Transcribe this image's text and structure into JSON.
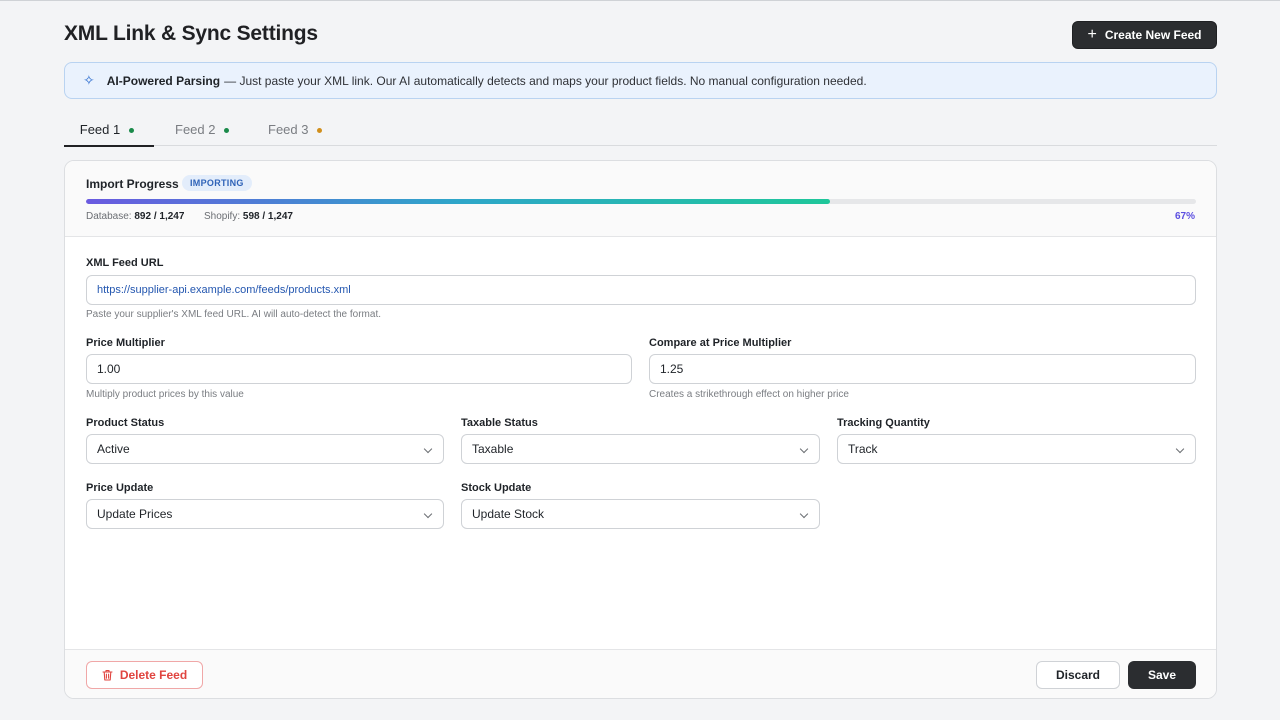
{
  "header": {
    "title": "XML Link & Sync Settings",
    "create_button_label": "Create New Feed"
  },
  "banner": {
    "icon": "sparkle-icon",
    "strong_text": "AI-Powered Parsing",
    "rest_text": "— Just paste your XML link. Our AI automatically detects and maps your product fields. No manual configuration needed."
  },
  "tabs": [
    {
      "label": "Feed 1",
      "status_color": "#1a8a4a",
      "active": true
    },
    {
      "label": "Feed 2",
      "status_color": "#1a8a4a",
      "active": false
    },
    {
      "label": "Feed 3",
      "status_color": "#d18f1c",
      "active": false
    }
  ],
  "progress": {
    "title": "Import Progress",
    "badge": "IMPORTING",
    "fraction": 0.67,
    "database_label": "Database:",
    "database_value": "892 / 1,247",
    "shopify_label": "Shopify:",
    "shopify_value": "598 / 1,247",
    "percent_text": "67%"
  },
  "form": {
    "url": {
      "label": "XML Feed URL",
      "value": "https://supplier-api.example.com/feeds/products.xml",
      "hint": "Paste your supplier's XML feed URL. AI will auto-detect the format."
    },
    "price_multiplier": {
      "label": "Price Multiplier",
      "value": "1.00",
      "hint": "Multiply product prices by this value"
    },
    "compare_multiplier": {
      "label": "Compare at Price Multiplier",
      "value": "1.25",
      "hint": "Creates a strikethrough effect on higher price"
    },
    "product_status": {
      "label": "Product Status",
      "value": "Active"
    },
    "taxable_status": {
      "label": "Taxable Status",
      "value": "Taxable"
    },
    "tracking_quantity": {
      "label": "Tracking Quantity",
      "value": "Track"
    },
    "price_update": {
      "label": "Price Update",
      "value": "Update Prices"
    },
    "stock_update": {
      "label": "Stock Update",
      "value": "Update Stock"
    }
  },
  "footer": {
    "delete_label": "Delete Feed",
    "discard_label": "Discard",
    "save_label": "Save"
  },
  "colors": {
    "primary_dark": "#2b2d30",
    "accent_blue": "#2f63b8",
    "danger": "#e0443f",
    "progress_percent": "#5b4ee0"
  }
}
